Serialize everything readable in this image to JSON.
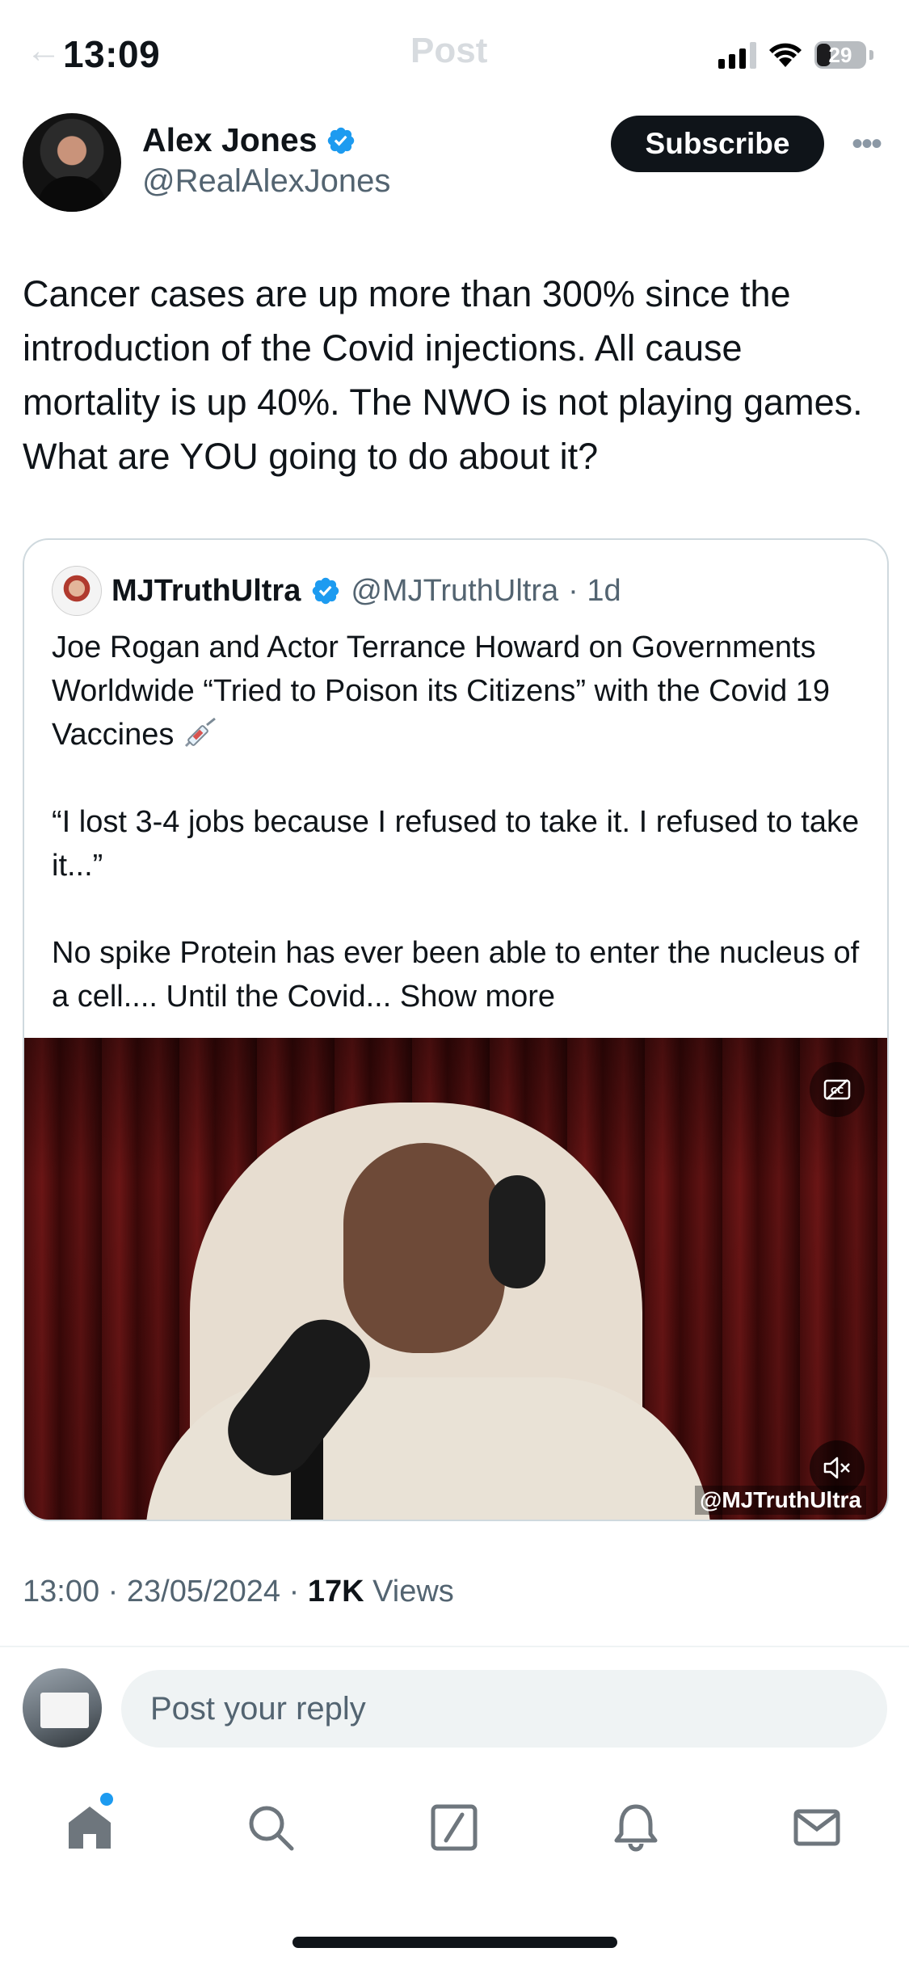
{
  "status_bar": {
    "time": "13:09",
    "battery": "29",
    "battery_level": 0.29,
    "ghost_back": "←",
    "ghost_title": "Post"
  },
  "post": {
    "author_name": "Alex Jones",
    "author_handle": "@RealAlexJones",
    "subscribe_label": "Subscribe",
    "more_label": "•••",
    "text": "Cancer cases are up more than 300% since the introduction of the Covid injections. All cause mortality is up 40%. The NWO is not playing games. What are YOU going to do about it?",
    "time": "13:00",
    "date": "23/05/2024",
    "views_count": "17K",
    "views_label": "Views",
    "separator": " · "
  },
  "quote": {
    "author_name": "MJTruthUltra",
    "author_handle": "@MJTruthUltra",
    "age": "· 1d",
    "paragraph_1": "Joe Rogan and Actor Terrance Howard on Governments Worldwide “Tried to Poison its Citizens” with the Covid 19 Vaccines",
    "paragraph_2": "“I lost 3-4 jobs because I refused to take it. I refused to take it...”",
    "paragraph_3": "No spike Protein has ever been able to enter the nucleus of a cell.... Until the Covid...",
    "show_more": "Show more",
    "video_watermark": "@MJTruthUltra"
  },
  "reply": {
    "placeholder": "Post your reply"
  },
  "icons": {
    "verified": "verified-badge-icon",
    "syringe": "syringe-emoji-icon",
    "captions": "captions-icon",
    "mute": "muted-speaker-icon",
    "home": "home-icon",
    "search": "search-icon",
    "grok": "grok-slash-icon",
    "notifications": "bell-icon",
    "messages": "envelope-icon"
  },
  "colors": {
    "accent": "#1d9bf0",
    "text_primary": "#0f1419",
    "text_secondary": "#536471",
    "icon_gray": "#6e767d"
  }
}
